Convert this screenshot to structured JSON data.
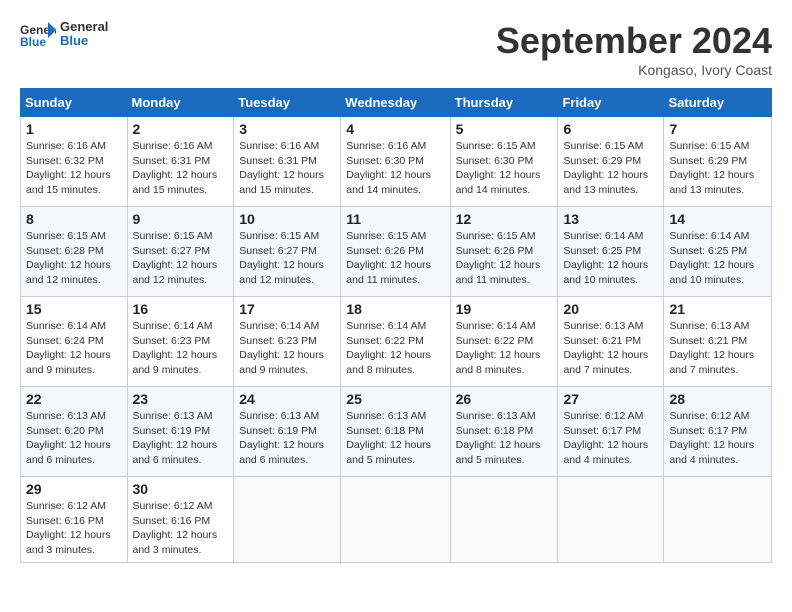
{
  "header": {
    "logo_text_general": "General",
    "logo_text_blue": "Blue",
    "month": "September 2024",
    "location": "Kongaso, Ivory Coast"
  },
  "weekdays": [
    "Sunday",
    "Monday",
    "Tuesday",
    "Wednesday",
    "Thursday",
    "Friday",
    "Saturday"
  ],
  "weeks": [
    [
      {
        "day": "1",
        "sunrise": "6:16 AM",
        "sunset": "6:32 PM",
        "daylight": "12 hours and 15 minutes."
      },
      {
        "day": "2",
        "sunrise": "6:16 AM",
        "sunset": "6:31 PM",
        "daylight": "12 hours and 15 minutes."
      },
      {
        "day": "3",
        "sunrise": "6:16 AM",
        "sunset": "6:31 PM",
        "daylight": "12 hours and 15 minutes."
      },
      {
        "day": "4",
        "sunrise": "6:16 AM",
        "sunset": "6:30 PM",
        "daylight": "12 hours and 14 minutes."
      },
      {
        "day": "5",
        "sunrise": "6:15 AM",
        "sunset": "6:30 PM",
        "daylight": "12 hours and 14 minutes."
      },
      {
        "day": "6",
        "sunrise": "6:15 AM",
        "sunset": "6:29 PM",
        "daylight": "12 hours and 13 minutes."
      },
      {
        "day": "7",
        "sunrise": "6:15 AM",
        "sunset": "6:29 PM",
        "daylight": "12 hours and 13 minutes."
      }
    ],
    [
      {
        "day": "8",
        "sunrise": "6:15 AM",
        "sunset": "6:28 PM",
        "daylight": "12 hours and 12 minutes."
      },
      {
        "day": "9",
        "sunrise": "6:15 AM",
        "sunset": "6:27 PM",
        "daylight": "12 hours and 12 minutes."
      },
      {
        "day": "10",
        "sunrise": "6:15 AM",
        "sunset": "6:27 PM",
        "daylight": "12 hours and 12 minutes."
      },
      {
        "day": "11",
        "sunrise": "6:15 AM",
        "sunset": "6:26 PM",
        "daylight": "12 hours and 11 minutes."
      },
      {
        "day": "12",
        "sunrise": "6:15 AM",
        "sunset": "6:26 PM",
        "daylight": "12 hours and 11 minutes."
      },
      {
        "day": "13",
        "sunrise": "6:14 AM",
        "sunset": "6:25 PM",
        "daylight": "12 hours and 10 minutes."
      },
      {
        "day": "14",
        "sunrise": "6:14 AM",
        "sunset": "6:25 PM",
        "daylight": "12 hours and 10 minutes."
      }
    ],
    [
      {
        "day": "15",
        "sunrise": "6:14 AM",
        "sunset": "6:24 PM",
        "daylight": "12 hours and 9 minutes."
      },
      {
        "day": "16",
        "sunrise": "6:14 AM",
        "sunset": "6:23 PM",
        "daylight": "12 hours and 9 minutes."
      },
      {
        "day": "17",
        "sunrise": "6:14 AM",
        "sunset": "6:23 PM",
        "daylight": "12 hours and 9 minutes."
      },
      {
        "day": "18",
        "sunrise": "6:14 AM",
        "sunset": "6:22 PM",
        "daylight": "12 hours and 8 minutes."
      },
      {
        "day": "19",
        "sunrise": "6:14 AM",
        "sunset": "6:22 PM",
        "daylight": "12 hours and 8 minutes."
      },
      {
        "day": "20",
        "sunrise": "6:13 AM",
        "sunset": "6:21 PM",
        "daylight": "12 hours and 7 minutes."
      },
      {
        "day": "21",
        "sunrise": "6:13 AM",
        "sunset": "6:21 PM",
        "daylight": "12 hours and 7 minutes."
      }
    ],
    [
      {
        "day": "22",
        "sunrise": "6:13 AM",
        "sunset": "6:20 PM",
        "daylight": "12 hours and 6 minutes."
      },
      {
        "day": "23",
        "sunrise": "6:13 AM",
        "sunset": "6:19 PM",
        "daylight": "12 hours and 6 minutes."
      },
      {
        "day": "24",
        "sunrise": "6:13 AM",
        "sunset": "6:19 PM",
        "daylight": "12 hours and 6 minutes."
      },
      {
        "day": "25",
        "sunrise": "6:13 AM",
        "sunset": "6:18 PM",
        "daylight": "12 hours and 5 minutes."
      },
      {
        "day": "26",
        "sunrise": "6:13 AM",
        "sunset": "6:18 PM",
        "daylight": "12 hours and 5 minutes."
      },
      {
        "day": "27",
        "sunrise": "6:12 AM",
        "sunset": "6:17 PM",
        "daylight": "12 hours and 4 minutes."
      },
      {
        "day": "28",
        "sunrise": "6:12 AM",
        "sunset": "6:17 PM",
        "daylight": "12 hours and 4 minutes."
      }
    ],
    [
      {
        "day": "29",
        "sunrise": "6:12 AM",
        "sunset": "6:16 PM",
        "daylight": "12 hours and 3 minutes."
      },
      {
        "day": "30",
        "sunrise": "6:12 AM",
        "sunset": "6:16 PM",
        "daylight": "12 hours and 3 minutes."
      },
      null,
      null,
      null,
      null,
      null
    ]
  ]
}
